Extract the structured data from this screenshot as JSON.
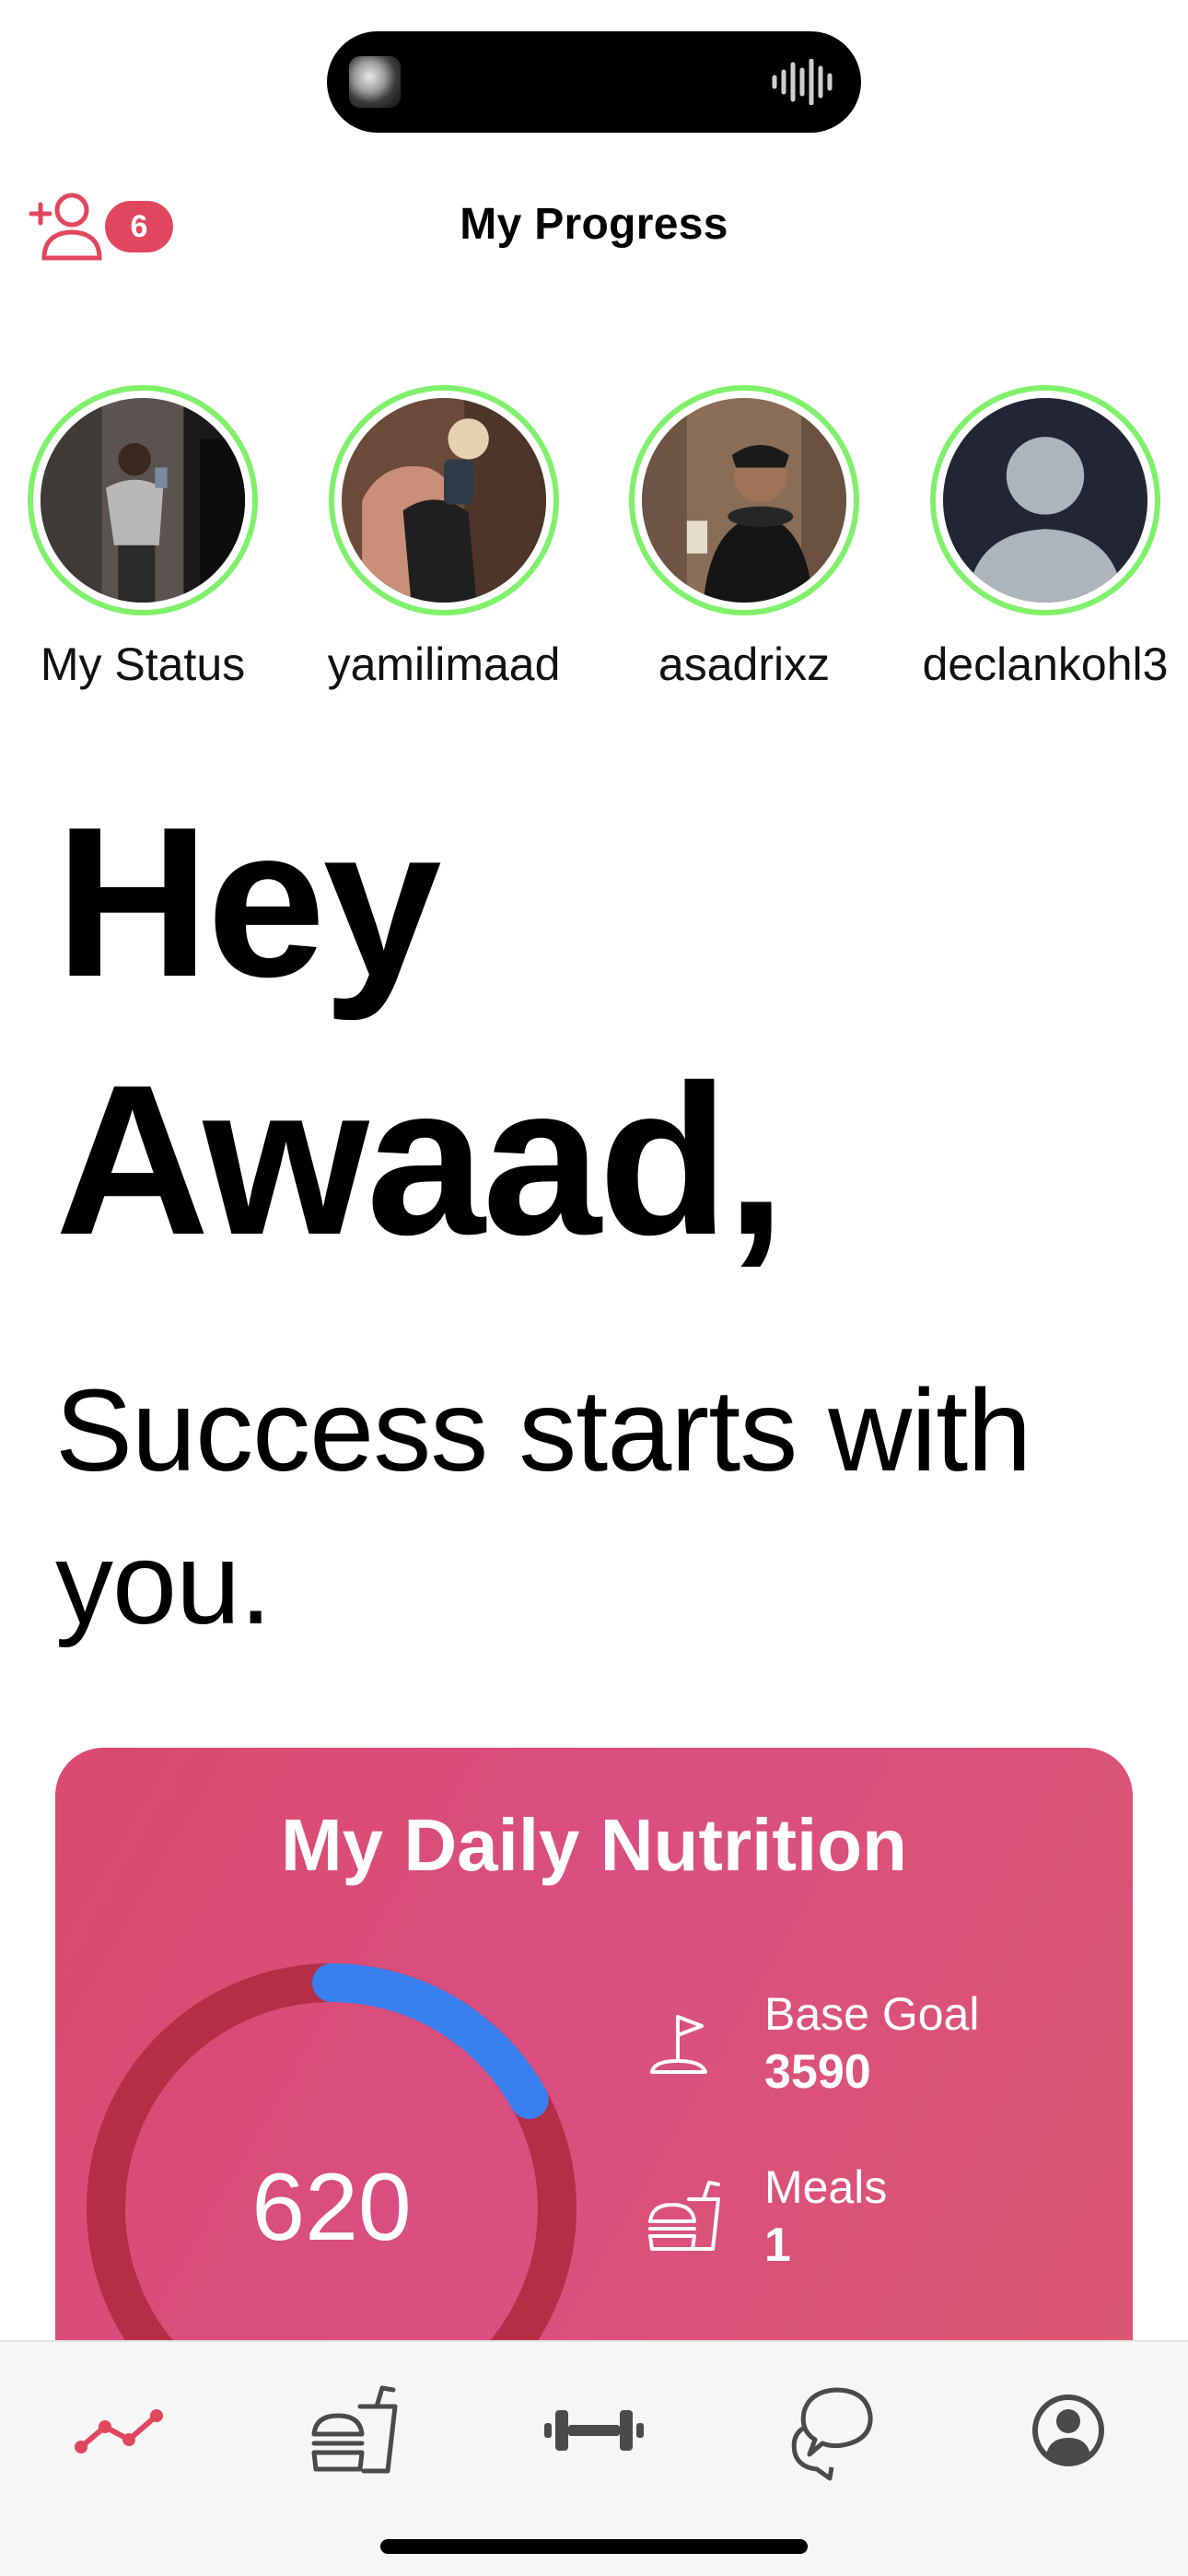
{
  "header": {
    "title": "My Progress",
    "friend_requests_count": "6"
  },
  "stories": [
    {
      "name": "My Status"
    },
    {
      "name": "yamilimaad"
    },
    {
      "name": "asadrixz"
    },
    {
      "name": "declankohl3"
    }
  ],
  "greeting": {
    "line1": "Hey",
    "line2": "Awaad,"
  },
  "tagline": "Success starts with you.",
  "nutrition": {
    "title": "My Daily Nutrition",
    "calories": "620",
    "progress_fraction": 0.17,
    "base_goal_label": "Base Goal",
    "base_goal_value": "3590",
    "meals_label": "Meals",
    "meals_value": "1"
  },
  "tabs": [
    {
      "icon": "progress-chart-icon",
      "active": true
    },
    {
      "icon": "food-icon",
      "active": false
    },
    {
      "icon": "dumbbell-icon",
      "active": false
    },
    {
      "icon": "chat-icon",
      "active": false
    },
    {
      "icon": "profile-icon",
      "active": false
    }
  ],
  "colors": {
    "accent": "#e0475f",
    "card": "#d94f80",
    "ring_track": "#b52e45",
    "ring_progress": "#3a7ff0",
    "story_ring": "#7ff06a"
  }
}
